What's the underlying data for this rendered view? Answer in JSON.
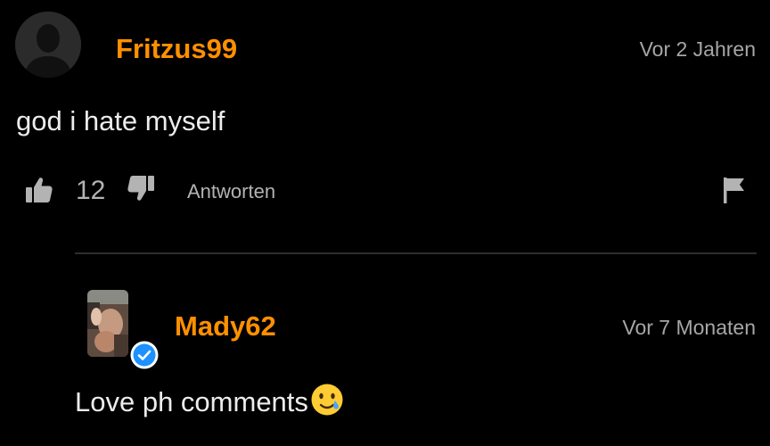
{
  "theme": {
    "background": "#000000",
    "username_color": "#ff9000",
    "secondary_text": "#a6a6a6",
    "verified_color": "#1e90ff"
  },
  "comment": {
    "avatar": "default-user-avatar-icon",
    "username": "Fritzus99",
    "timestamp": "Vor 2 Jahren",
    "text": "god i hate myself",
    "actions": {
      "like_icon": "thumbs-up-icon",
      "like_count": "12",
      "dislike_icon": "thumbs-down-icon",
      "reply_label": "Antworten",
      "flag_icon": "flag-icon"
    }
  },
  "reply": {
    "avatar": "user-photo-avatar",
    "verified_icon": "verified-check-icon",
    "username": "Mady62",
    "timestamp": "Vor 7 Monaten",
    "text": "Love ph comments",
    "emoji": "smiling-face-with-tear-emoji"
  }
}
